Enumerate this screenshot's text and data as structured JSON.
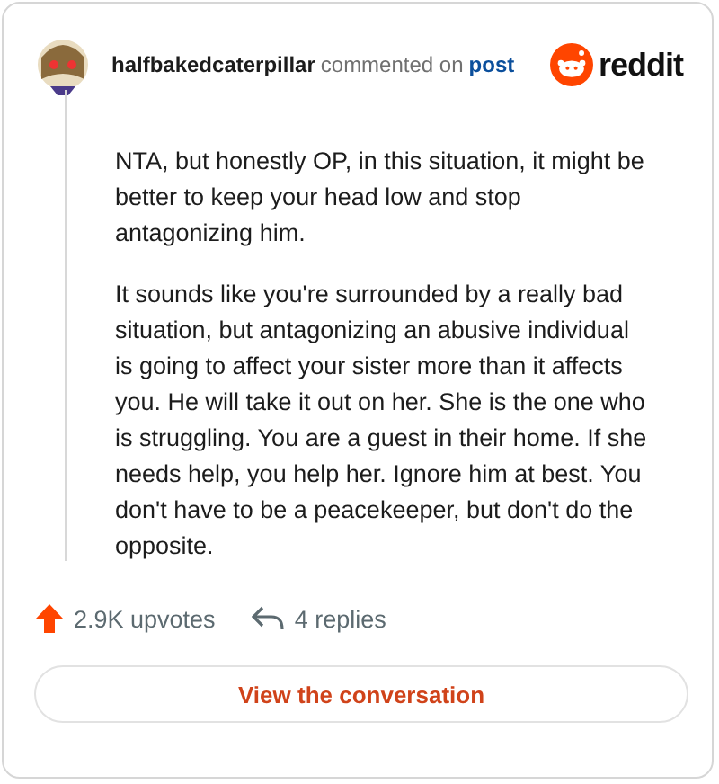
{
  "header": {
    "username": "halfbakedcaterpillar",
    "action": "commented on",
    "link": "post",
    "brand": "reddit"
  },
  "paragraphs": [
    "NTA, but honestly OP, in this situation, it might be better to keep your head low and stop antagonizing him.",
    "It sounds like you're surrounded by a really bad situation, but antagonizing an abusive individual is going to affect your sister more than it affects you. He will take it out on her. She is the one who is struggling. You are a guest in their home. If she needs help, you help her. Ignore him at best. You don't have to be a peacekeeper, but don't do the opposite."
  ],
  "stats": {
    "upvotes": "2.9K upvotes",
    "replies": "4 replies"
  },
  "button": "View the conversation"
}
